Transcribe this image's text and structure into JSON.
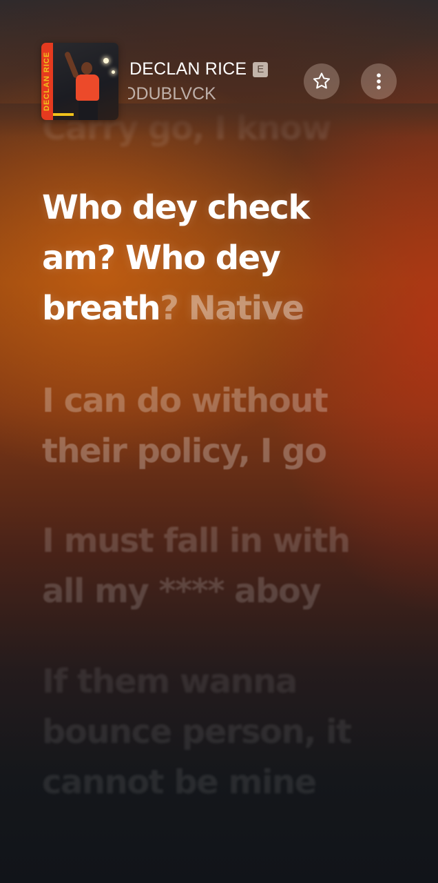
{
  "now_playing": {
    "album_art_label": "DECLAN RICE",
    "title": "DECLAN RICE",
    "explicit_badge": "E",
    "artist": "ODUBLVCK"
  },
  "buttons": {
    "favorite_icon": "star-outline-icon",
    "more_icon": "vertical-ellipsis-icon"
  },
  "lyrics": {
    "previous_line": "Carry go, I know",
    "current": {
      "line_1": "Who dey check",
      "line_2": "am? Who dey",
      "line_3_sung": "breath",
      "line_3_upcoming": "? Native"
    },
    "next": [
      {
        "lines": [
          "I can do without",
          "their policy, I go"
        ]
      },
      {
        "lines": [
          "I must fall in with",
          "all my **** aboy"
        ]
      },
      {
        "lines": [
          "If them wanna",
          "bounce person, it",
          "cannot be mine"
        ]
      }
    ]
  },
  "colors": {
    "accent_orange": "#8e4410",
    "accent_red": "#be3016",
    "background_dark": "#111419"
  }
}
